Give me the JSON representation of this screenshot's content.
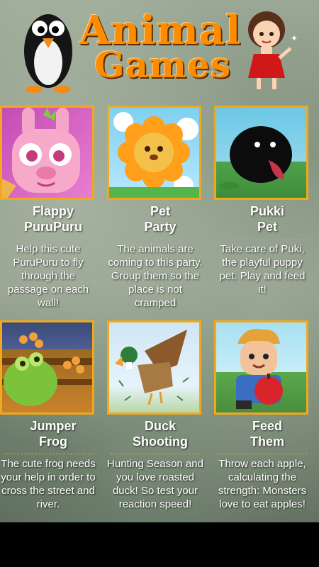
{
  "app": {
    "logo_line1": "Animal",
    "logo_line2": "Games",
    "accent_color": "#f2a81d"
  },
  "games": [
    {
      "title_line1": "Flappy",
      "title_line2": "PuruPuru",
      "description": "Help this cute PuruPuru to fly through the passage on each wall!",
      "thumb_icon": "pink-bunny-icon"
    },
    {
      "title_line1": "Pet",
      "title_line2": "Party",
      "description": "The animals are coming to this party. Group them so the place is not cramped",
      "thumb_icon": "flower-lion-icon"
    },
    {
      "title_line1": "Pukki",
      "title_line2": "Pet",
      "description": "Take care of Puki, the playful puppy pet: Play and feed it!",
      "thumb_icon": "black-puppy-icon"
    },
    {
      "title_line1": "Jumper",
      "title_line2": "Frog",
      "description": "The cute frog needs your help in order to cross the street and river.",
      "thumb_icon": "frog-icon"
    },
    {
      "title_line1": "Duck",
      "title_line2": "Shooting",
      "description": "Hunting Season and you love roasted duck! So test your reaction speed!",
      "thumb_icon": "duck-icon"
    },
    {
      "title_line1": "Feed",
      "title_line2": "Them",
      "description": "Throw each apple, calculating the strength: Monsters love to eat apples!",
      "thumb_icon": "boy-apple-icon"
    }
  ]
}
